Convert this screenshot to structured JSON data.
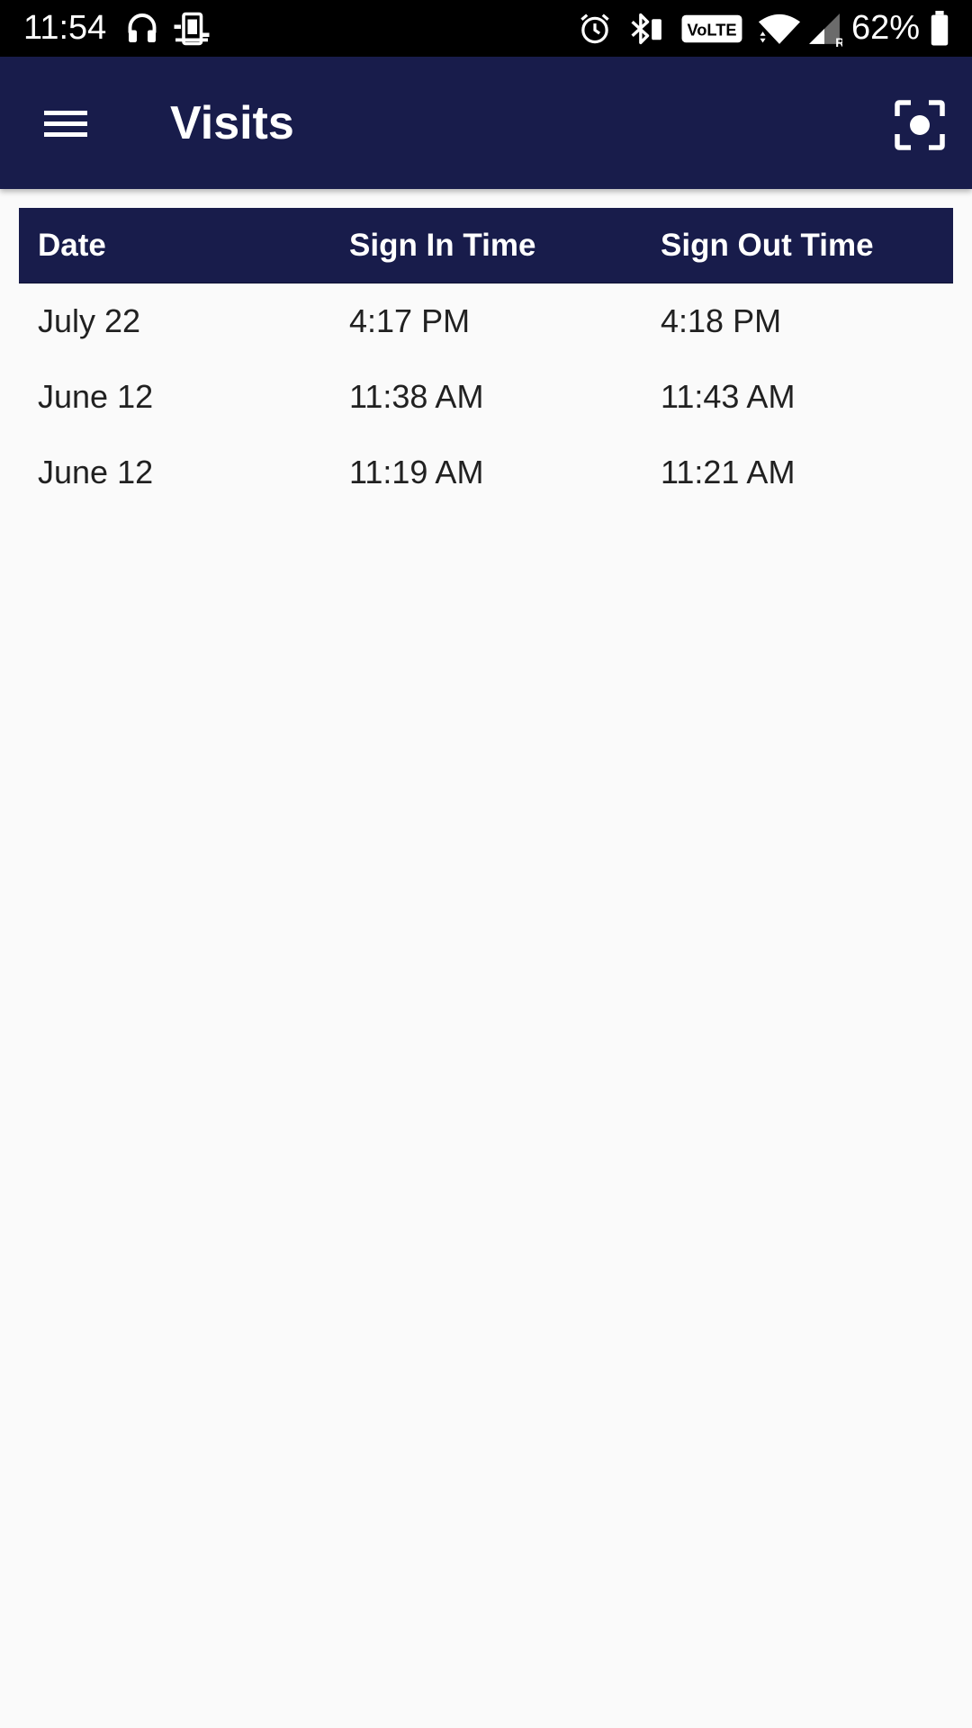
{
  "status_bar": {
    "time": "11:54",
    "battery_percent": "62%",
    "volte_label": "VoLTE",
    "roaming_label": "R",
    "icons": [
      "headphones-icon",
      "screen-mirror-icon",
      "alarm-icon",
      "bluetooth-icon",
      "volte-icon",
      "wifi-icon",
      "cell-signal-icon",
      "battery-icon"
    ]
  },
  "app_bar": {
    "title": "Visits",
    "menu_icon": "hamburger-menu-icon",
    "action_icon": "scan-focus-icon",
    "background_color": "#181c4b"
  },
  "table": {
    "columns": [
      "Date",
      "Sign In Time",
      "Sign Out Time"
    ],
    "rows": [
      {
        "date": "July 22",
        "sign_in": "4:17 PM",
        "sign_out": "4:18 PM"
      },
      {
        "date": "June 12",
        "sign_in": "11:38 AM",
        "sign_out": "11:43 AM"
      },
      {
        "date": "June 12",
        "sign_in": "11:19 AM",
        "sign_out": "11:21 AM"
      }
    ]
  }
}
